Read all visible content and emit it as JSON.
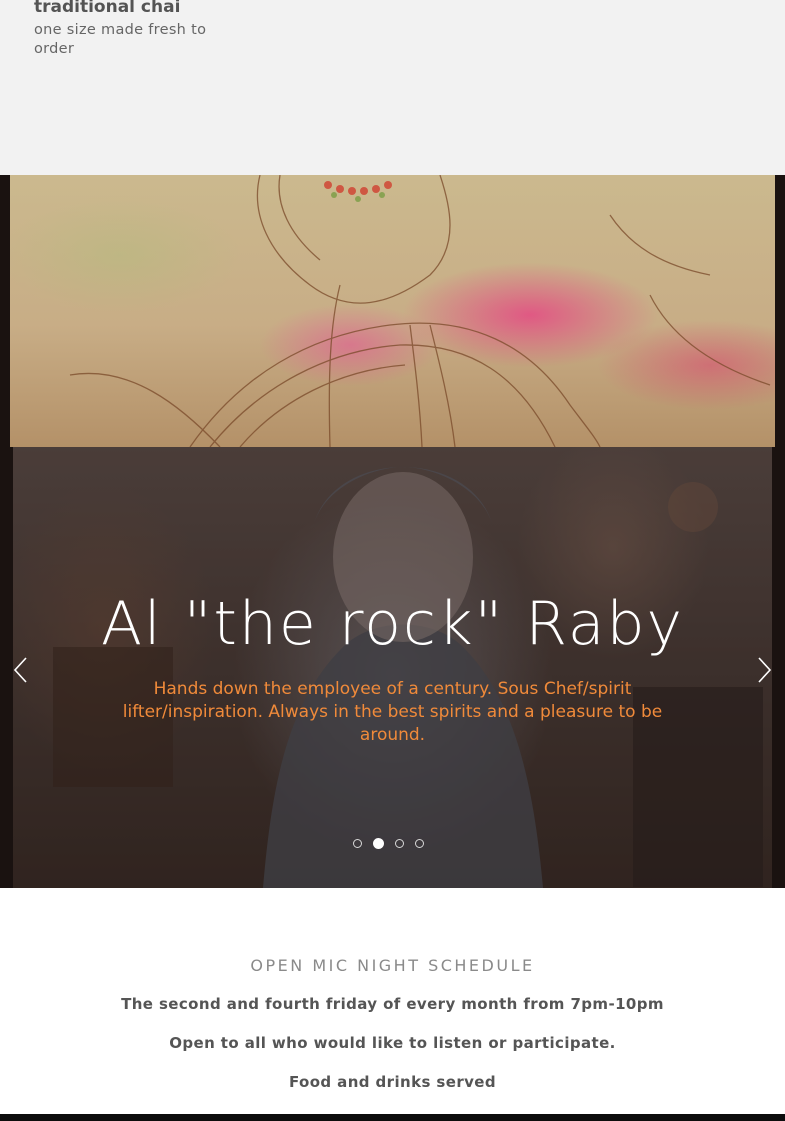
{
  "menu": {
    "item": {
      "name": "traditional chai",
      "description": "one size made fresh to order"
    }
  },
  "slider": {
    "slide": {
      "title": "Al \"the rock\" Raby",
      "caption": "Hands down the employee of a century. Sous Chef/spirit lifter/inspiration. Always in the best spirits and a pleasure to be around."
    },
    "active_dot": 2,
    "dot_count": 4,
    "caption_color": "#f08a3a"
  },
  "schedule": {
    "heading": "OPEN MIC NIGHT SCHEDULE",
    "line_1": "The second and fourth friday of every month from 7pm-10pm",
    "line_2": "Open to all who would like to listen or participate.",
    "line_3": "Food and drinks served"
  },
  "icons": {
    "prev": "chevron-left-icon",
    "next": "chevron-right-icon"
  }
}
